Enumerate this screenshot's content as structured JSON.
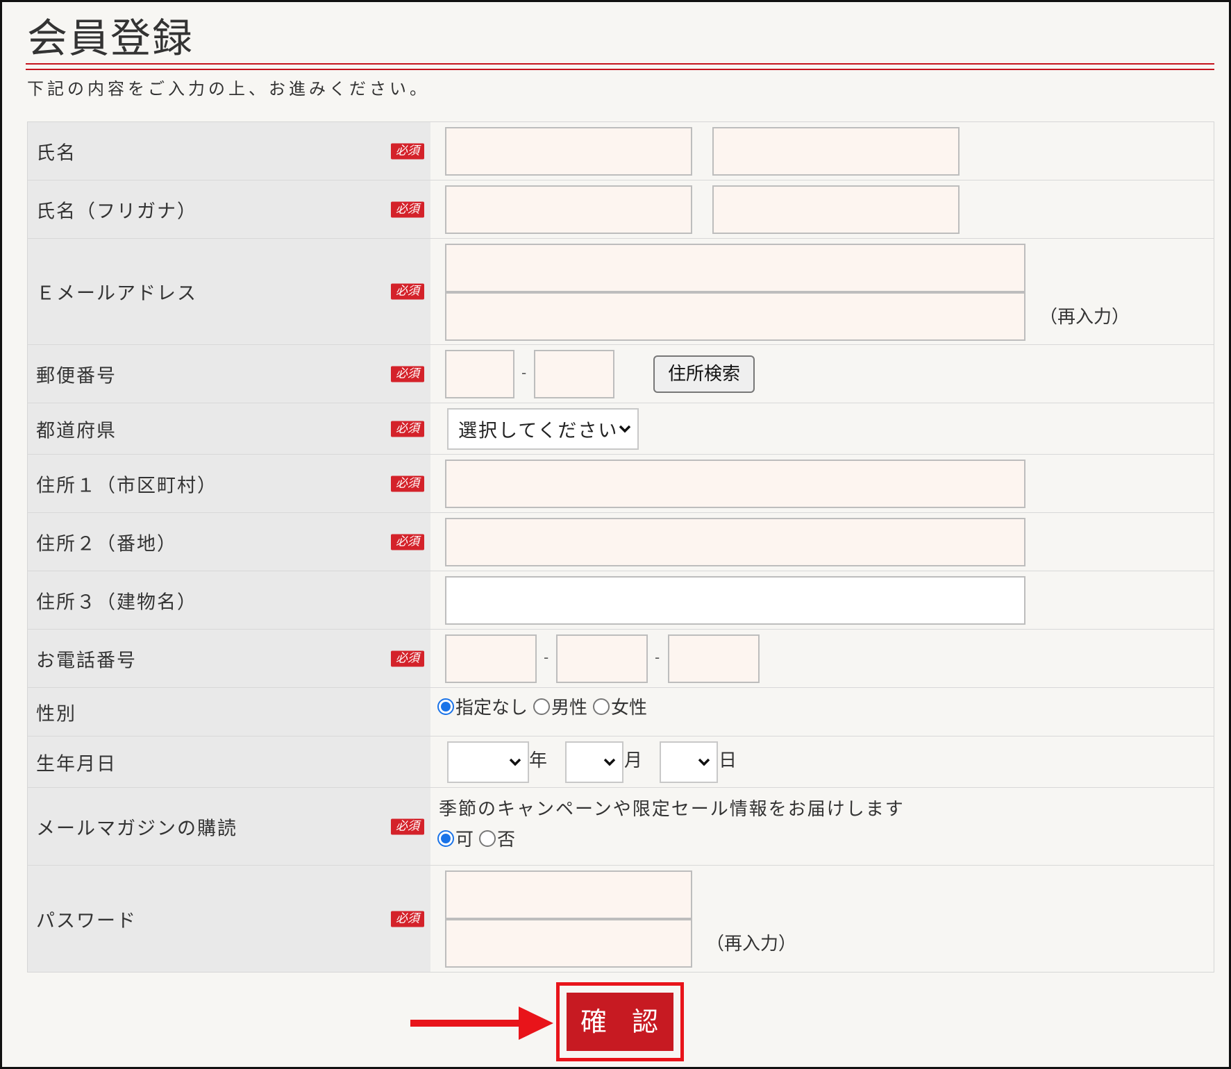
{
  "page": {
    "title": "会員登録",
    "intro": "下記の内容をご入力の上、お進みください。",
    "required_badge": "必須",
    "accent_color": "#c5141d"
  },
  "fields": {
    "name": {
      "label": "氏名"
    },
    "kana": {
      "label": "氏名（フリガナ）"
    },
    "email": {
      "label": "Ｅメールアドレス",
      "reenter_note": "（再入力）"
    },
    "postal": {
      "label": "郵便番号",
      "separator": "-",
      "search_button": "住所検索"
    },
    "prefecture": {
      "label": "都道府県",
      "selected": "選択してください"
    },
    "address1": {
      "label": "住所１（市区町村）"
    },
    "address2": {
      "label": "住所２（番地）"
    },
    "address3": {
      "label": "住所３（建物名）"
    },
    "phone": {
      "label": "お電話番号",
      "separator": "-"
    },
    "gender": {
      "label": "性別",
      "options": [
        "指定なし",
        "男性",
        "女性"
      ],
      "selected": "指定なし"
    },
    "birthday": {
      "label": "生年月日",
      "year_unit": "年",
      "month_unit": "月",
      "day_unit": "日"
    },
    "newsletter": {
      "label": "メールマガジンの購読",
      "description": "季節のキャンペーンや限定セール情報をお届けします",
      "options": [
        "可",
        "否"
      ],
      "selected": "可"
    },
    "password": {
      "label": "パスワード",
      "reenter_note": "（再入力）"
    }
  },
  "confirm_button": "確 認"
}
